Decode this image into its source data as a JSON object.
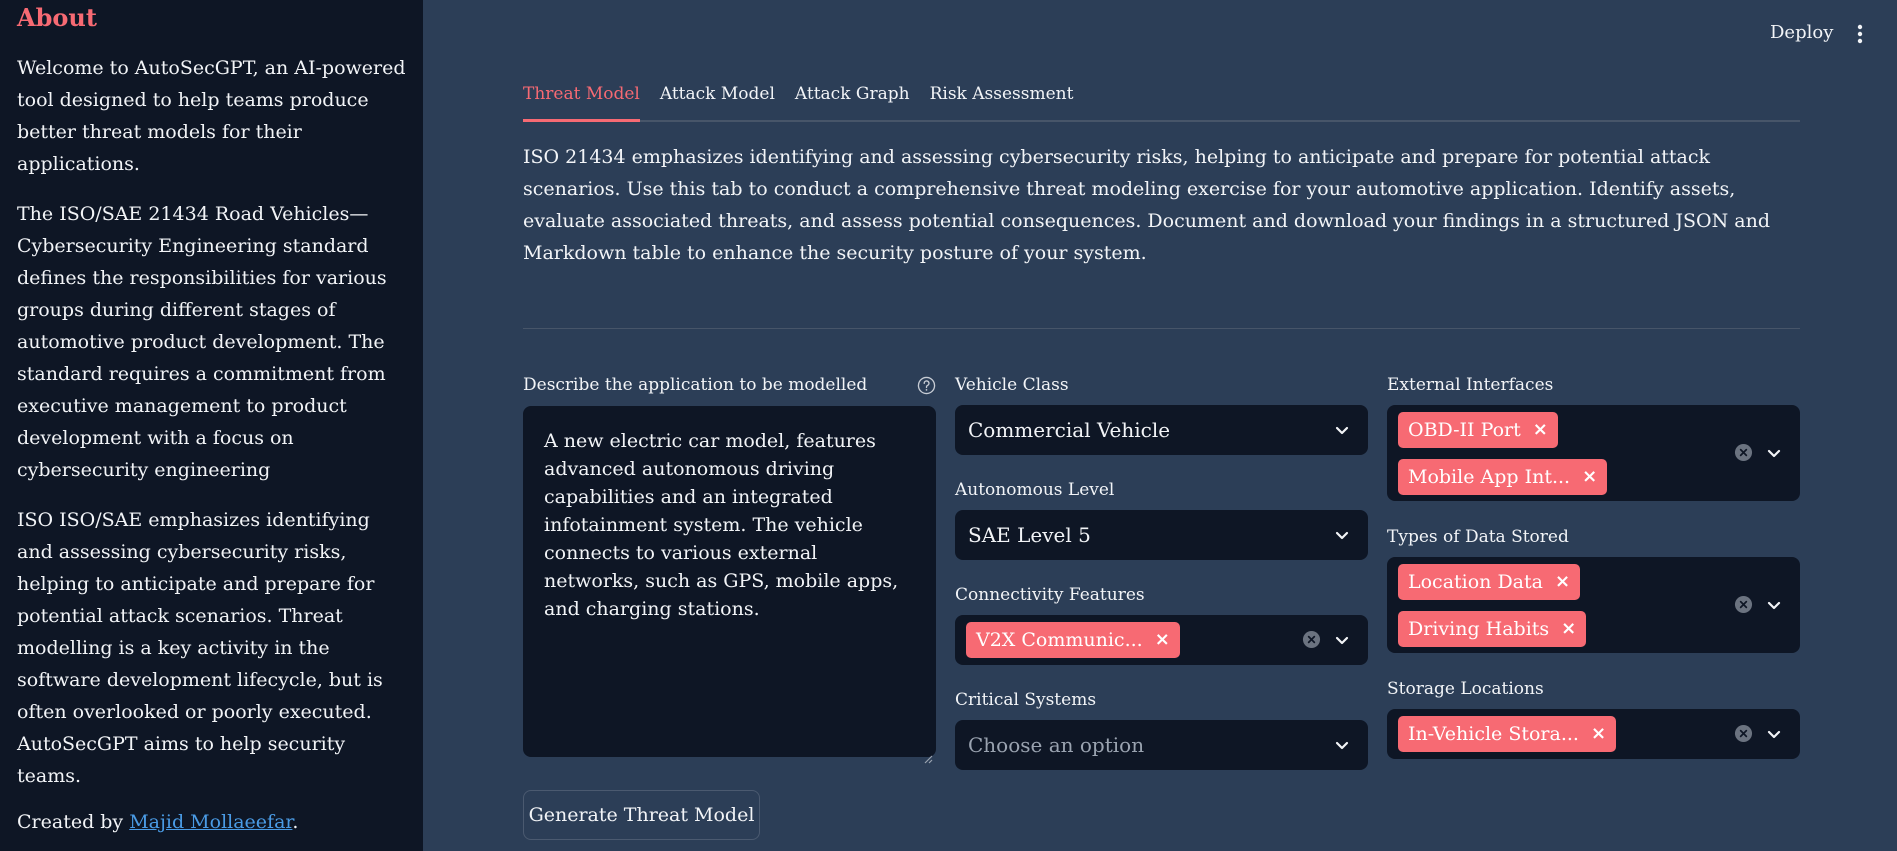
{
  "sidebar": {
    "title": "About",
    "paragraphs": [
      "Welcome to AutoSecGPT, an AI-powered tool designed to help teams produce better threat models for their applications.",
      "The ISO/SAE 21434 Road Vehicles—Cybersecurity Engineering standard defines the responsibilities for various groups during different stages of automotive product development. The standard requires a commitment from executive management to product development with a focus on cybersecurity engineering",
      "ISO ISO/SAE emphasizes identifying and assessing cybersecurity risks, helping to anticipate and prepare for potential attack scenarios. Threat modelling is a key activity in the software development lifecycle, but is often overlooked or poorly executed. AutoSecGPT aims to help security teams."
    ],
    "credit_prefix": "Created by ",
    "credit_link": "Majid Mollaeefar",
    "credit_suffix": "."
  },
  "header": {
    "deploy_label": "Deploy",
    "menu_icon": "kebab-menu-icon"
  },
  "tabs": [
    {
      "label": "Threat Model",
      "active": true
    },
    {
      "label": "Attack Model",
      "active": false
    },
    {
      "label": "Attack Graph",
      "active": false
    },
    {
      "label": "Risk Assessment",
      "active": false
    }
  ],
  "intro": "ISO 21434 emphasizes identifying and assessing cybersecurity risks, helping to anticipate and prepare for potential attack scenarios. Use this tab to conduct a comprehensive threat modeling exercise for your automotive application. Identify assets, evaluate associated threats, and assess potential consequences. Document and download your findings in a structured JSON and Markdown table to enhance the security posture of your system.",
  "form": {
    "description": {
      "label": "Describe the application to be modelled",
      "value": "A new electric car model, features advanced autonomous driving capabilities and an integrated infotainment system.  The vehicle connects to various external networks, such as GPS, mobile apps, and charging stations."
    },
    "vehicle_class": {
      "label": "Vehicle Class",
      "value": "Commercial Vehicle"
    },
    "autonomous_level": {
      "label": "Autonomous Level",
      "value": "SAE Level 5"
    },
    "connectivity": {
      "label": "Connectivity Features",
      "chips": [
        "V2X Communic..."
      ]
    },
    "critical_systems": {
      "label": "Critical Systems",
      "placeholder": "Choose an option"
    },
    "external_interfaces": {
      "label": "External Interfaces",
      "chips": [
        "OBD-II Port",
        "Mobile App Int..."
      ]
    },
    "data_stored": {
      "label": "Types of Data Stored",
      "chips": [
        "Location Data",
        "Driving Habits"
      ]
    },
    "storage_locations": {
      "label": "Storage Locations",
      "chips": [
        "In-Vehicle Stora..."
      ]
    },
    "generate_button": "Generate Threat Model"
  },
  "colors": {
    "accent": "#f76a73",
    "sidebar_bg": "#0e1625",
    "main_bg": "#2c3e57",
    "link": "#4a9be5"
  }
}
